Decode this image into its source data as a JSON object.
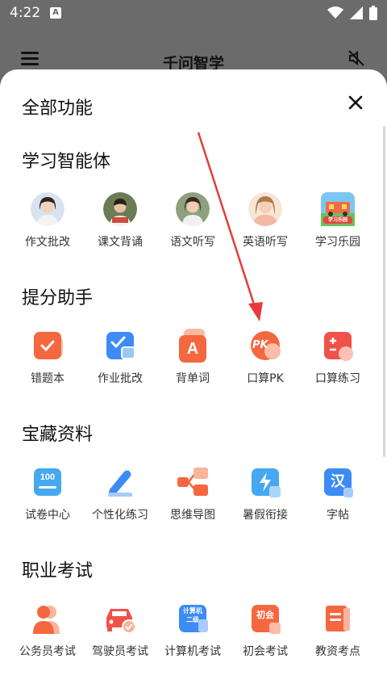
{
  "status_bar": {
    "time": "4:22",
    "a_badge": "A"
  },
  "app": {
    "title": "千问智学"
  },
  "sheet": {
    "title": "全部功能",
    "sections": [
      {
        "title": "学习智能体",
        "items": [
          {
            "label": "作文批改",
            "icon": "girl-avatar-icon"
          },
          {
            "label": "课文背诵",
            "icon": "boy-reading-avatar-icon"
          },
          {
            "label": "语文听写",
            "icon": "girl-avatar-icon"
          },
          {
            "label": "英语听写",
            "icon": "woman-avatar-icon"
          },
          {
            "label": "学习乐园",
            "icon": "playground-icon",
            "badge": "学习乐园"
          }
        ]
      },
      {
        "title": "提分助手",
        "items": [
          {
            "label": "错题本",
            "icon": "notebook-icon"
          },
          {
            "label": "作业批改",
            "icon": "homework-check-icon"
          },
          {
            "label": "背单词",
            "icon": "letter-a-icon",
            "glyph": "A"
          },
          {
            "label": "口算PK",
            "icon": "pk-icon",
            "glyph": "PK"
          },
          {
            "label": "口算练习",
            "icon": "calculator-icon"
          }
        ]
      },
      {
        "title": "宝藏资料",
        "items": [
          {
            "label": "试卷中心",
            "icon": "exam-paper-icon",
            "glyph": "100"
          },
          {
            "label": "个性化练习",
            "icon": "pen-icon"
          },
          {
            "label": "思维导图",
            "icon": "mindmap-icon"
          },
          {
            "label": "暑假衔接",
            "icon": "lightning-icon"
          },
          {
            "label": "字帖",
            "icon": "copybook-icon",
            "glyph": "汉"
          }
        ]
      },
      {
        "title": "职业考试",
        "items": [
          {
            "label": "公务员考试",
            "icon": "civil-servant-icon"
          },
          {
            "label": "驾驶员考试",
            "icon": "car-icon"
          },
          {
            "label": "计算机考试",
            "icon": "computer-exam-icon",
            "glyph": "计算机二级"
          },
          {
            "label": "初会考试",
            "icon": "accounting-exam-icon",
            "glyph": "初会"
          },
          {
            "label": "教资考点",
            "icon": "teacher-book-icon"
          }
        ]
      }
    ]
  },
  "colors": {
    "accent_red": "#f0524a",
    "blue": "#3d8bf5",
    "orange": "#f5673f"
  }
}
